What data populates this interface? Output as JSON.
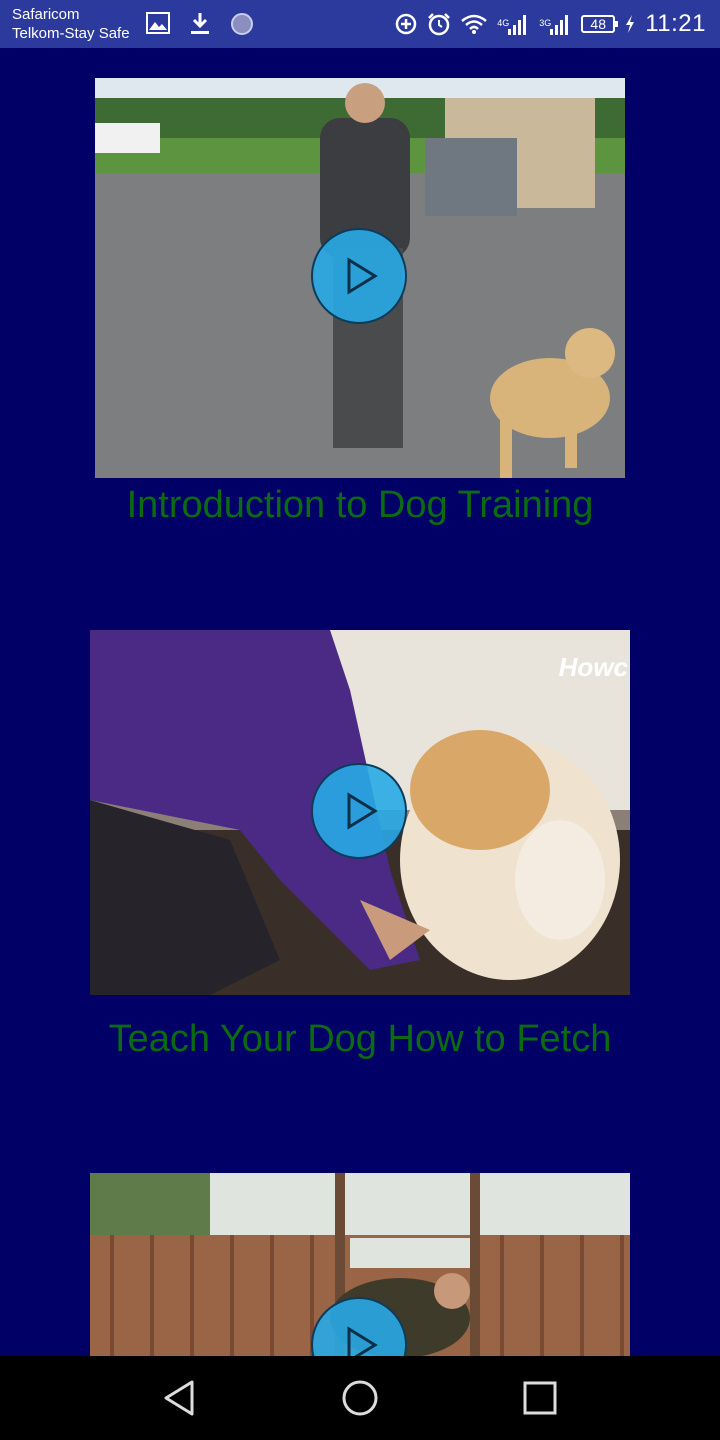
{
  "status_bar": {
    "carrier_1": "Safaricom",
    "carrier_2": "Telkom-Stay Safe",
    "net_1": "4G",
    "net_2": "3G",
    "battery": "48",
    "time": "11:21"
  },
  "videos": [
    {
      "title": "Introduction to Dog Training"
    },
    {
      "title": "Teach Your Dog How to Fetch",
      "watermark": "Howc"
    },
    {
      "title": ""
    }
  ],
  "colors": {
    "background": "#000066",
    "title_text": "#0b6b12",
    "play_button": "#28aae6",
    "status_bar": "#2b3a9c"
  }
}
